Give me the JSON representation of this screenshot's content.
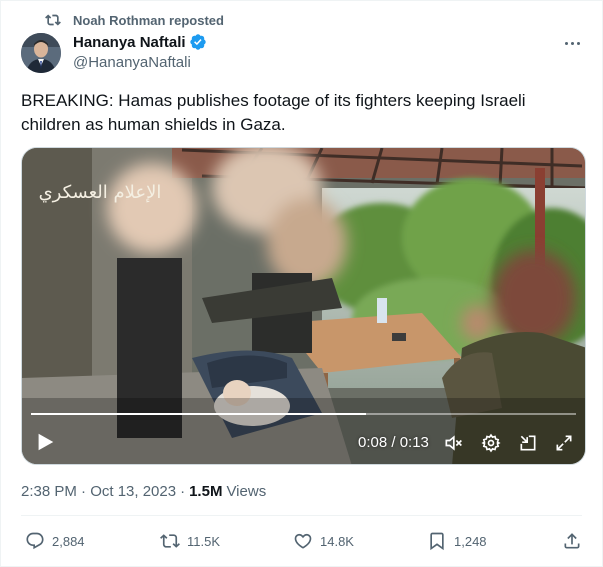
{
  "repost": {
    "label": "Noah Rothman reposted"
  },
  "author": {
    "name": "Hananya Naftali",
    "handle": "@HananyaNaftali"
  },
  "tweet": {
    "text": "BREAKING: Hamas publishes footage of its fighters keeping Israeli children as human shields in Gaza."
  },
  "video": {
    "watermark": "الإعلام العسكري",
    "time": "0:08 / 0:13",
    "progress": 0.615
  },
  "meta": {
    "timestamp": "2:38 PM · Oct 13, 2023",
    "separator": "·",
    "views_count": "1.5M",
    "views_label": "Views"
  },
  "actions": {
    "replies": "2,884",
    "reposts": "11.5K",
    "likes": "14.8K",
    "bookmarks": "1,248"
  },
  "colors": {
    "accent": "#1d9bf0",
    "muted": "#536471",
    "text": "#0f1419"
  }
}
